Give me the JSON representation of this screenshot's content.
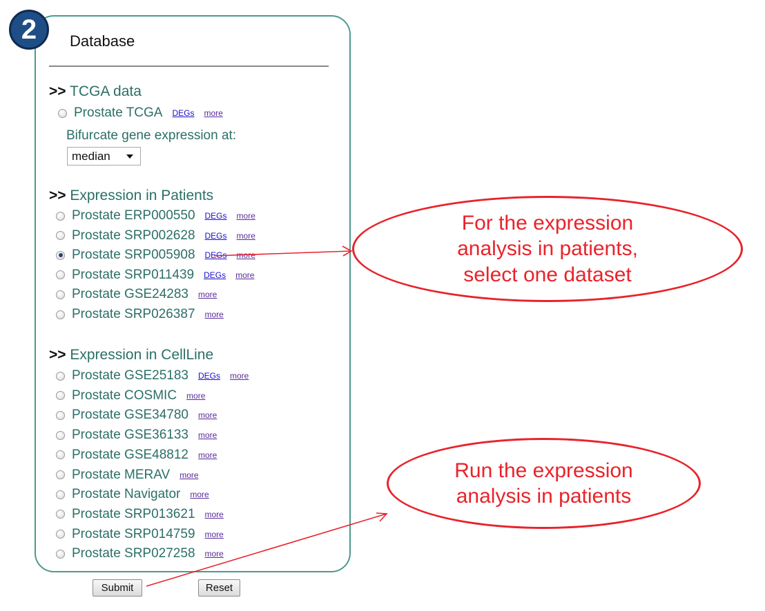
{
  "step_badge": "2",
  "database": {
    "title": "Database"
  },
  "tcga": {
    "heading_prefix": ">>",
    "heading": "TCGA data",
    "dataset": {
      "label": "Prostate TCGA",
      "degs": "DEGs",
      "more": "more"
    },
    "bifurcate_label": "Bifurcate gene expression at:",
    "bifurcate_selected": "median"
  },
  "patients": {
    "heading_prefix": ">>",
    "heading": "Expression in Patients",
    "datasets": [
      {
        "label": "Prostate ERP000550",
        "degs": "DEGs",
        "more": "more",
        "checked": false
      },
      {
        "label": "Prostate SRP002628",
        "degs": "DEGs",
        "more": "more",
        "checked": false
      },
      {
        "label": "Prostate SRP005908",
        "degs": "DEGs",
        "more": "more",
        "checked": true
      },
      {
        "label": "Prostate SRP011439",
        "degs": "DEGs",
        "more": "more",
        "checked": false
      },
      {
        "label": "Prostate GSE24283",
        "more": "more",
        "checked": false
      },
      {
        "label": "Prostate SRP026387",
        "more": "more",
        "checked": false
      }
    ]
  },
  "cellline": {
    "heading_prefix": ">>",
    "heading": "Expression in CellLine",
    "datasets": [
      {
        "label": "Prostate GSE25183",
        "degs": "DEGs",
        "more": "more"
      },
      {
        "label": "Prostate COSMIC",
        "more": "more"
      },
      {
        "label": "Prostate GSE34780",
        "more": "more"
      },
      {
        "label": "Prostate GSE36133",
        "more": "more"
      },
      {
        "label": "Prostate GSE48812",
        "more": "more"
      },
      {
        "label": "Prostate MERAV",
        "more": "more"
      },
      {
        "label": "Prostate Navigator",
        "more": "more"
      },
      {
        "label": "Prostate SRP013621",
        "more": "more"
      },
      {
        "label": "Prostate SRP014759",
        "more": "more"
      },
      {
        "label": "Prostate SRP027258",
        "more": "more"
      }
    ]
  },
  "buttons": {
    "submit": "Submit",
    "reset": "Reset"
  },
  "callouts": {
    "select": "For the expression\nanalysis in patients,\nselect one dataset",
    "run": "Run the expression\nanalysis in patients"
  },
  "colors": {
    "panel_border": "#4c9a8c",
    "heading_text": "#2b6f66",
    "callout_red": "#e8232b",
    "badge": "#1f4e86"
  }
}
